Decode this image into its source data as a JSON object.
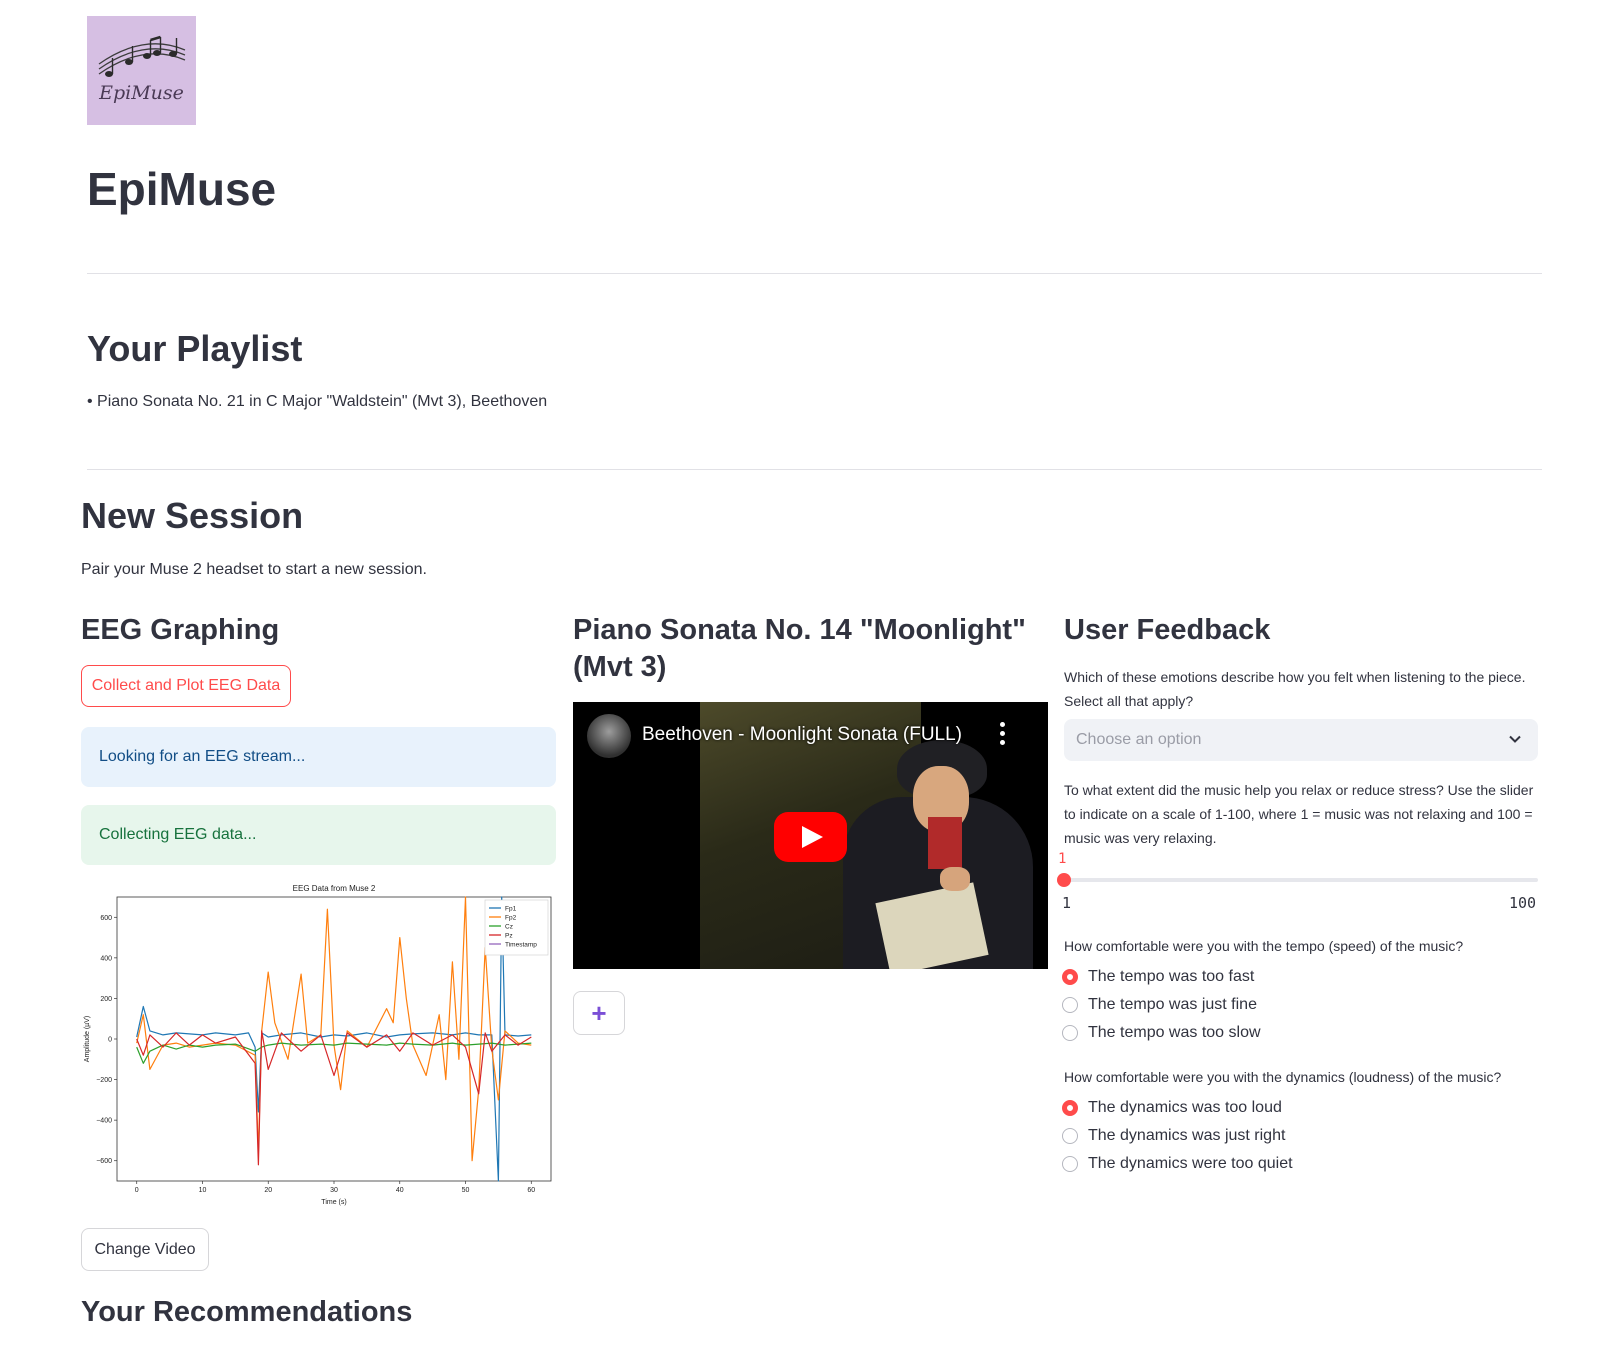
{
  "app": {
    "logo_text": "EpiMuse",
    "title": "EpiMuse"
  },
  "playlist": {
    "heading": "Your Playlist",
    "items": [
      "• Piano Sonata No. 21 in C Major \"Waldstein\" (Mvt 3), Beethoven"
    ]
  },
  "session": {
    "heading": "New Session",
    "subtitle": "Pair your Muse 2 headset to start a new session."
  },
  "eeg": {
    "heading": "EEG Graphing",
    "collect_button": "Collect and Plot EEG Data",
    "info_message": "Looking for an EEG stream...",
    "success_message": "Collecting EEG data...",
    "change_video_button": "Change Video"
  },
  "video": {
    "heading": "Piano Sonata No. 14 \"Moonlight\" (Mvt 3)",
    "title": "Beethoven - Moonlight Sonata (FULL)",
    "add_button": "+"
  },
  "feedback": {
    "heading": "User Feedback",
    "emotions_question": "Which of these emotions describe how you felt when listening to the piece. Select all that apply?",
    "emotions_placeholder": "Choose an option",
    "relax_question": "To what extent did the music help you relax or reduce stress? Use the slider to indicate on a scale of 1-100, where 1 = music was not relaxing and 100 = music was very relaxing.",
    "slider_value": "1",
    "slider_min": "1",
    "slider_max": "100",
    "tempo_question": "How comfortable were you with the tempo (speed) of the music?",
    "tempo_options": [
      "The tempo was too fast",
      "The tempo was just fine",
      "The tempo was too slow"
    ],
    "tempo_selected": 0,
    "dynamics_question": "How comfortable were you with the dynamics (loudness) of the music?",
    "dynamics_options": [
      "The dynamics was too loud",
      "The dynamics was just right",
      "The dynamics were too quiet"
    ],
    "dynamics_selected": 0
  },
  "recommendations": {
    "heading": "Your Recommendations"
  },
  "colors": {
    "accent": "#ff4b4b",
    "info_bg": "#e8f2fc",
    "success_bg": "#e7f6ec",
    "logo_bg": "#d6bfe3"
  },
  "chart_data": {
    "type": "line",
    "title": "EEG Data from Muse 2",
    "xlabel": "Time (s)",
    "ylabel": "Amplitude (µV)",
    "xlim": [
      -3,
      63
    ],
    "ylim": [
      -700,
      700
    ],
    "xticks": [
      0,
      10,
      20,
      30,
      40,
      50,
      60
    ],
    "yticks": [
      -600,
      -400,
      -200,
      0,
      200,
      400,
      600
    ],
    "legend_position": "top-right",
    "series": [
      {
        "name": "Fp1",
        "color": "#1f77b4",
        "points": [
          [
            0,
            10
          ],
          [
            1,
            160
          ],
          [
            2,
            40
          ],
          [
            4,
            20
          ],
          [
            6,
            30
          ],
          [
            8,
            25
          ],
          [
            10,
            20
          ],
          [
            12,
            30
          ],
          [
            15,
            20
          ],
          [
            17,
            30
          ],
          [
            18,
            -40
          ],
          [
            18.5,
            -360
          ],
          [
            19,
            30
          ],
          [
            20,
            10
          ],
          [
            22,
            20
          ],
          [
            25,
            30
          ],
          [
            28,
            10
          ],
          [
            30,
            20
          ],
          [
            32,
            15
          ],
          [
            35,
            30
          ],
          [
            38,
            10
          ],
          [
            40,
            20
          ],
          [
            42,
            25
          ],
          [
            45,
            30
          ],
          [
            48,
            20
          ],
          [
            50,
            30
          ],
          [
            52,
            20
          ],
          [
            54,
            20
          ],
          [
            55,
            -700
          ],
          [
            55.5,
            700
          ],
          [
            56,
            20
          ],
          [
            58,
            15
          ],
          [
            60,
            20
          ]
        ]
      },
      {
        "name": "Fp2",
        "color": "#ff7f0e",
        "points": [
          [
            0,
            -20
          ],
          [
            1,
            120
          ],
          [
            2,
            -150
          ],
          [
            4,
            -30
          ],
          [
            6,
            -20
          ],
          [
            8,
            -40
          ],
          [
            10,
            -30
          ],
          [
            12,
            -20
          ],
          [
            15,
            -30
          ],
          [
            18,
            -80
          ],
          [
            18.5,
            -560
          ],
          [
            19,
            40
          ],
          [
            20,
            330
          ],
          [
            21,
            80
          ],
          [
            23,
            -100
          ],
          [
            25,
            320
          ],
          [
            26,
            -20
          ],
          [
            28,
            20
          ],
          [
            29,
            640
          ],
          [
            30,
            -30
          ],
          [
            31,
            -250
          ],
          [
            32,
            40
          ],
          [
            35,
            -40
          ],
          [
            38,
            150
          ],
          [
            39,
            80
          ],
          [
            40,
            500
          ],
          [
            41,
            200
          ],
          [
            42,
            -30
          ],
          [
            44,
            -180
          ],
          [
            46,
            120
          ],
          [
            47,
            -200
          ],
          [
            48,
            380
          ],
          [
            49,
            -100
          ],
          [
            50,
            700
          ],
          [
            51,
            -600
          ],
          [
            52,
            -250
          ],
          [
            53,
            450
          ],
          [
            54,
            -50
          ],
          [
            55,
            -300
          ],
          [
            56,
            40
          ],
          [
            58,
            -20
          ],
          [
            60,
            -30
          ]
        ]
      },
      {
        "name": "Cz",
        "color": "#2ca02c",
        "points": [
          [
            0,
            -40
          ],
          [
            1,
            -120
          ],
          [
            2,
            -60
          ],
          [
            4,
            -30
          ],
          [
            6,
            -50
          ],
          [
            8,
            -30
          ],
          [
            10,
            -40
          ],
          [
            12,
            -30
          ],
          [
            15,
            -25
          ],
          [
            18,
            -60
          ],
          [
            19,
            -40
          ],
          [
            20,
            -30
          ],
          [
            22,
            -20
          ],
          [
            25,
            -30
          ],
          [
            28,
            -25
          ],
          [
            30,
            -30
          ],
          [
            32,
            -20
          ],
          [
            35,
            -25
          ],
          [
            38,
            -30
          ],
          [
            40,
            -20
          ],
          [
            42,
            -25
          ],
          [
            45,
            -30
          ],
          [
            48,
            -20
          ],
          [
            50,
            -30
          ],
          [
            52,
            -25
          ],
          [
            54,
            -20
          ],
          [
            56,
            -30
          ],
          [
            58,
            -25
          ],
          [
            60,
            -20
          ]
        ]
      },
      {
        "name": "Pz",
        "color": "#d62728",
        "points": [
          [
            0,
            0
          ],
          [
            1,
            -80
          ],
          [
            2,
            20
          ],
          [
            4,
            -40
          ],
          [
            6,
            30
          ],
          [
            8,
            -30
          ],
          [
            10,
            20
          ],
          [
            12,
            -20
          ],
          [
            15,
            10
          ],
          [
            18,
            -120
          ],
          [
            18.5,
            -620
          ],
          [
            19,
            40
          ],
          [
            20,
            -150
          ],
          [
            22,
            30
          ],
          [
            25,
            -60
          ],
          [
            28,
            20
          ],
          [
            30,
            -180
          ],
          [
            32,
            30
          ],
          [
            35,
            -40
          ],
          [
            38,
            20
          ],
          [
            40,
            -60
          ],
          [
            42,
            30
          ],
          [
            45,
            -30
          ],
          [
            48,
            20
          ],
          [
            50,
            -40
          ],
          [
            52,
            -270
          ],
          [
            53,
            30
          ],
          [
            54,
            -60
          ],
          [
            56,
            20
          ],
          [
            58,
            -30
          ],
          [
            60,
            10
          ]
        ]
      },
      {
        "name": "Timestamp",
        "color": "#9467bd",
        "points": []
      }
    ]
  }
}
